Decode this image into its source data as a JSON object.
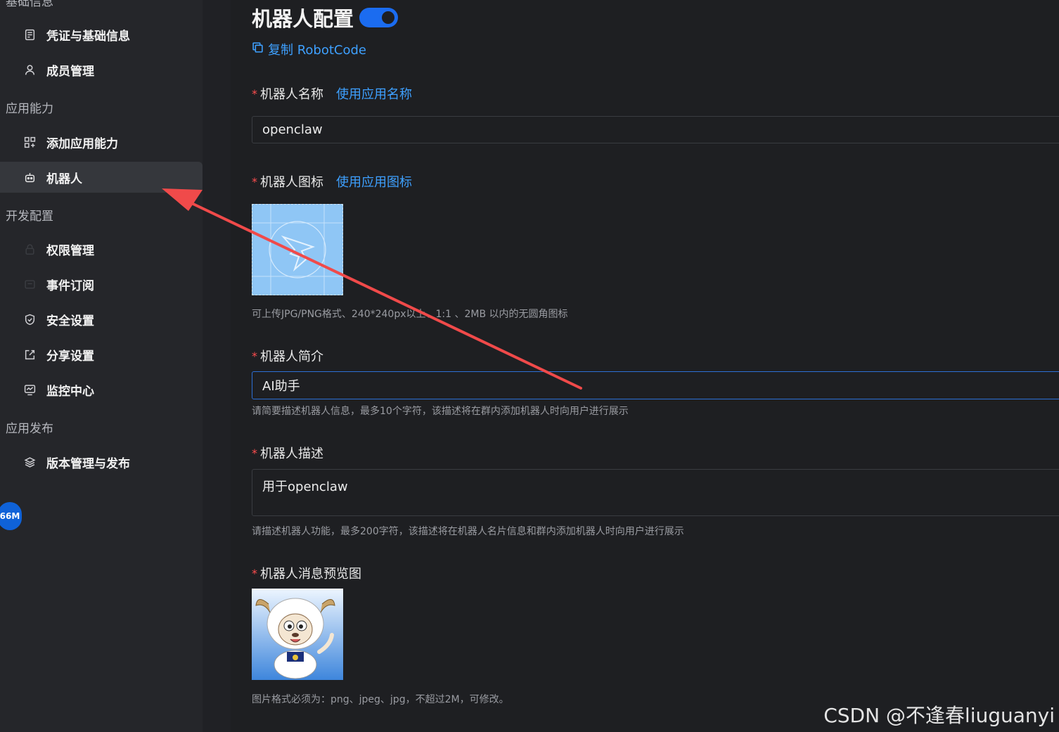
{
  "sidebar": {
    "top_cut_title": "基础信息",
    "sections": {
      "basic_items": [
        {
          "label": "凭证与基础信息",
          "icon": "credential-icon"
        },
        {
          "label": "成员管理",
          "icon": "member-icon"
        }
      ],
      "capability_title": "应用能力",
      "capability_items": [
        {
          "label": "添加应用能力",
          "icon": "apps-grid-icon"
        },
        {
          "label": "机器人",
          "icon": "robot-icon",
          "active": true
        }
      ],
      "dev_title": "开发配置",
      "dev_items": [
        {
          "label": "权限管理",
          "icon": "lock-icon"
        },
        {
          "label": "事件订阅",
          "icon": "subscribe-icon"
        },
        {
          "label": "安全设置",
          "icon": "shield-icon"
        },
        {
          "label": "分享设置",
          "icon": "share-icon"
        },
        {
          "label": "监控中心",
          "icon": "monitor-icon"
        }
      ],
      "publish_title": "应用发布",
      "publish_items": [
        {
          "label": "版本管理与发布",
          "icon": "layers-icon"
        }
      ]
    },
    "badge": "66M"
  },
  "main": {
    "title": "机器人配置",
    "toggle_on": true,
    "copy_link": "复制 RobotCode",
    "name_field": {
      "required": "*",
      "label": "机器人名称",
      "side_link": "使用应用名称",
      "value": "openclaw"
    },
    "icon_field": {
      "required": "*",
      "label": "机器人图标",
      "side_link": "使用应用图标",
      "hint": "可上传JPG/PNG格式、240*240px以上、1:1 、2MB 以内的无圆角图标"
    },
    "intro_field": {
      "required": "*",
      "label": "机器人简介",
      "value": "AI助手",
      "hint": "请简要描述机器人信息，最多10个字符，该描述将在群内添加机器人时向用户进行展示"
    },
    "desc_field": {
      "required": "*",
      "label": "机器人描述",
      "value": "用于openclaw",
      "hint": "请描述机器人功能，最多200字符，该描述将在机器人名片信息和群内添加机器人时向用户进行展示"
    },
    "preview_field": {
      "required": "*",
      "label": "机器人消息预览图",
      "hint": "图片格式必须为：png、jpeg、jpg，不超过2M，可修改。"
    }
  },
  "watermark": "CSDN @不逢春liuguanyi",
  "colors": {
    "accent": "#3ea0ff",
    "toggle": "#1b6cf0",
    "required": "#ff4d4f",
    "arrow": "#f04a4a"
  }
}
